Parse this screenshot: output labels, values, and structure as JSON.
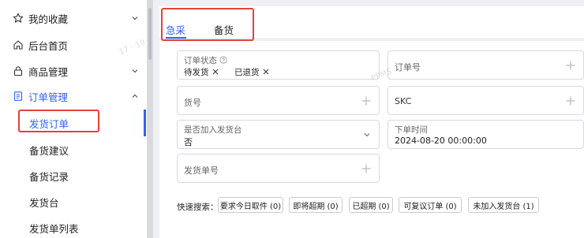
{
  "sidebar": {
    "items": [
      {
        "label": "我的收藏",
        "icon": "star-icon",
        "chevron": "down"
      },
      {
        "label": "后台首页",
        "icon": "home-icon"
      },
      {
        "label": "商品管理",
        "icon": "lock-icon",
        "chevron": "down"
      },
      {
        "label": "订单管理",
        "icon": "document-icon",
        "chevron": "up",
        "accent": "#2f63f0"
      }
    ],
    "sub_items": [
      {
        "label": "发货订单",
        "active": true
      },
      {
        "label": "备货建议"
      },
      {
        "label": "备货记录"
      },
      {
        "label": "发货台"
      },
      {
        "label": "发货单列表"
      }
    ]
  },
  "tabs": [
    {
      "label": "急采",
      "active": true
    },
    {
      "label": "备货",
      "active": false
    }
  ],
  "filters": {
    "order_status": {
      "label": "订单状态",
      "tags": [
        "待发货",
        "已退货"
      ]
    },
    "order_number": {
      "label": "订单号"
    },
    "item_number": {
      "label": "货号"
    },
    "skc": {
      "label": "SKC"
    },
    "added_to_shipping": {
      "label": "是否加入发货台",
      "value": "否"
    },
    "order_time": {
      "label": "下单时间",
      "value": "2024-08-20 00:00:00"
    },
    "shipment_number": {
      "label": "发货单号"
    }
  },
  "quick_search": {
    "label": "快速搜索：",
    "buttons": [
      "要求今日取件 (0)",
      "即将超期 (0)",
      "已超期 (0)",
      "可复议订单 (0)",
      "未加入发货台 (1)"
    ]
  },
  "colors": {
    "accent": "#2f63f0",
    "highlight_border": "#e0433b"
  }
}
